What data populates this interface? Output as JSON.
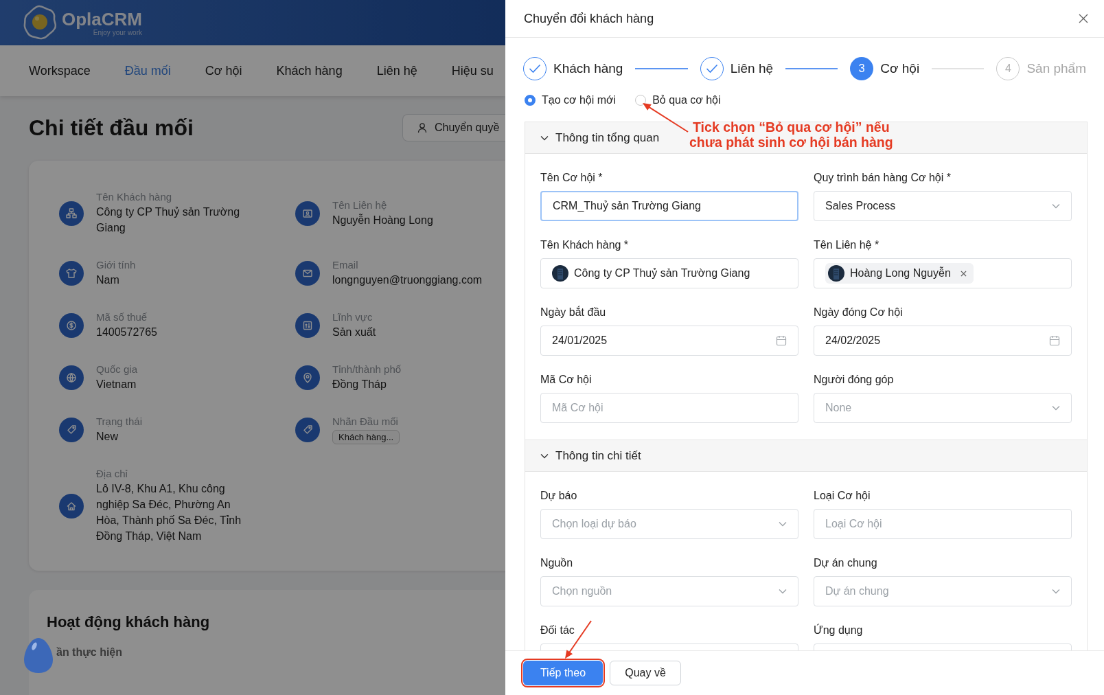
{
  "header": {
    "logo_name": "OplaCRM",
    "logo_tagline": "Enjoy your work"
  },
  "nav": [
    {
      "label": "Workspace",
      "selected": false
    },
    {
      "label": "Đầu mối",
      "selected": true
    },
    {
      "label": "Cơ hội",
      "selected": false
    },
    {
      "label": "Khách hàng",
      "selected": false
    },
    {
      "label": "Liên hệ",
      "selected": false
    },
    {
      "label": "Hiệu su",
      "selected": false
    }
  ],
  "page_title": "Chi tiết đầu mối",
  "transfer_button": "Chuyển quyề",
  "details": [
    {
      "label": "Tên Khách hàng",
      "value": "Công ty CP Thuỷ sản Trường Giang",
      "kind": "text"
    },
    {
      "label": "Tên Liên hệ",
      "value": "Nguyễn Hoàng Long",
      "kind": "text"
    },
    {
      "label": "Giới tính",
      "value": "Nam",
      "kind": "text"
    },
    {
      "label": "Email",
      "value": "longnguyen@truonggiang.com",
      "kind": "text"
    },
    {
      "label": "Mã số thuế",
      "value": "1400572765",
      "kind": "text"
    },
    {
      "label": "Lĩnh vực",
      "value": "Sản xuất",
      "kind": "text"
    },
    {
      "label": "Quốc gia",
      "value": "Vietnam",
      "kind": "text"
    },
    {
      "label": "Tỉnh/thành phố",
      "value": "Đồng Tháp",
      "kind": "text"
    },
    {
      "label": "Trạng thái",
      "value": "New",
      "kind": "text"
    },
    {
      "label": "Nhãn Đầu mối",
      "value": "Khách hàng...",
      "kind": "tag"
    },
    {
      "label": "Địa chỉ",
      "value": "Lô IV-8, Khu A1, Khu công nghiệp Sa Đéc, Phường An Hòa, Thành phố Sa Đéc, Tỉnh Đồng Tháp, Việt Nam",
      "kind": "text"
    }
  ],
  "activity": {
    "title": "Hoạt động khách hàng",
    "tab": "ần thực hiện"
  },
  "drawer": {
    "title": "Chuyển đổi khách hàng",
    "steps": [
      {
        "label": "Khách hàng",
        "completed": true,
        "selected": false
      },
      {
        "label": "Liên hệ",
        "completed": true,
        "selected": false
      },
      {
        "number": "3",
        "label": "Cơ hội",
        "completed": false,
        "selected": true
      },
      {
        "number": "4",
        "label": "Sản phẩm",
        "completed": false,
        "selected": false
      }
    ],
    "options": [
      {
        "label": "Tạo cơ hội mới",
        "selected": true
      },
      {
        "label": "Bỏ qua cơ hội",
        "selected": false
      }
    ],
    "sections": [
      {
        "title": "Thông tin tổng quan",
        "expanded": true,
        "fields": [
          {
            "label": "Tên Cơ hội *",
            "kind": "text",
            "value": "CRM_Thuỷ sản Trường Giang",
            "focused": true
          },
          {
            "label": "Quy trình bán hàng Cơ hội *",
            "kind": "select",
            "value": "Sales Process",
            "focused": false
          },
          {
            "label": "Tên Khách hàng *",
            "kind": "entity",
            "value": "Công ty CP Thuỷ sản Trường Giang",
            "focused": false
          },
          {
            "label": "Tên Liên hệ *",
            "kind": "chip",
            "value": "Hoàng Long Nguyễn",
            "focused": false
          },
          {
            "label": "Ngày bắt đầu",
            "kind": "date",
            "value": "24/01/2025",
            "focused": false
          },
          {
            "label": "Ngày đóng Cơ hội",
            "kind": "date",
            "value": "24/02/2025",
            "focused": false
          },
          {
            "label": "Mã Cơ hội",
            "kind": "text",
            "placeholder": "Mã Cơ hội",
            "focused": false
          },
          {
            "label": "Người đóng góp",
            "kind": "select",
            "placeholder": "None",
            "focused": false
          }
        ]
      },
      {
        "title": "Thông tin chi tiết",
        "expanded": true,
        "fields": [
          {
            "label": "Dự báo",
            "kind": "select",
            "placeholder": "Chọn loại dự báo",
            "focused": false
          },
          {
            "label": "Loại Cơ hội",
            "kind": "text",
            "placeholder": "Loại Cơ hội",
            "focused": false
          },
          {
            "label": "Nguồn",
            "kind": "select",
            "placeholder": "Chọn nguồn",
            "focused": false
          },
          {
            "label": "Dự án chung",
            "kind": "select",
            "placeholder": "Dự án chung",
            "focused": false
          },
          {
            "label": "Đối tác",
            "kind": "text",
            "focused": false
          },
          {
            "label": "Ứng dụng",
            "kind": "text",
            "focused": false
          }
        ]
      }
    ],
    "buttons": [
      {
        "label": "Tiếp theo",
        "kind": "primary",
        "highlighted": true
      },
      {
        "label": "Quay về",
        "kind": "secondary",
        "highlighted": false
      }
    ],
    "annotation": {
      "lines": [
        "Tick chọn “Bỏ qua cơ hội” nếu",
        "chưa phát sinh cơ hội bán hàng"
      ]
    }
  }
}
